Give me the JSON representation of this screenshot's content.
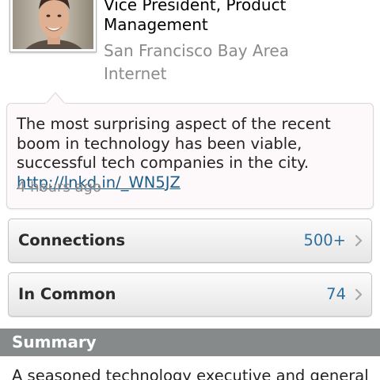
{
  "profile": {
    "title": "Vice President, Product Management",
    "location": "San Francisco Bay Area",
    "industry": "Internet"
  },
  "status": {
    "text": "The most surprising aspect of the recent boom in technology has been viable, successful tech companies in the city.",
    "link": "http://lnkd.in/_WN5JZ",
    "time": "4 hours ago"
  },
  "connections": {
    "label": "Connections",
    "count": "500+"
  },
  "in_common": {
    "label": "In Common",
    "count": "74"
  },
  "summary": {
    "header": "Summary",
    "text": "A seasoned technology executive and general"
  },
  "colors": {
    "link": "#1a5d8a",
    "count": "#2d6fa0",
    "section_header": "#878a8a"
  }
}
